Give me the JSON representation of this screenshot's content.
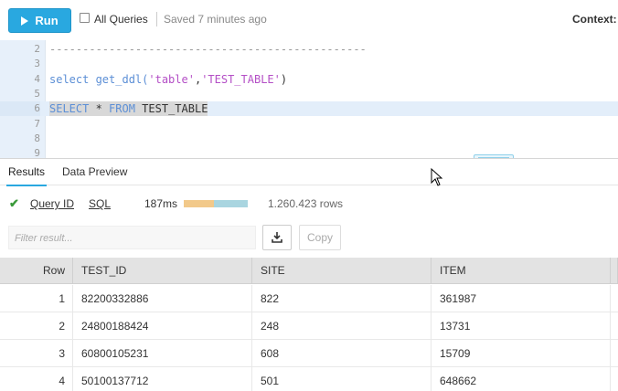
{
  "toolbar": {
    "run_label": "Run",
    "all_queries_label": "All Queries",
    "all_queries_checked": false,
    "saved_status": "Saved 7 minutes ago",
    "context_label": "Context:"
  },
  "editor": {
    "lines": [
      {
        "num": "2",
        "text": "------------------------------------------------"
      },
      {
        "num": "3",
        "text": ""
      },
      {
        "num": "4",
        "parts": [
          "select get_ddl(",
          "'table'",
          ",",
          "'TEST_TABLE'",
          ")"
        ]
      },
      {
        "num": "5",
        "text": ""
      },
      {
        "num": "6",
        "parts": [
          "SELECT",
          " * ",
          "FROM",
          " TEST_TABLE"
        ]
      },
      {
        "num": "7",
        "text": ""
      },
      {
        "num": "8",
        "text": ""
      },
      {
        "num": "9",
        "text": ""
      }
    ]
  },
  "results": {
    "tabs": [
      "Results",
      "Data Preview"
    ],
    "active_tab": "Results",
    "query_id_label": "Query ID",
    "sql_label": "SQL",
    "duration": "187ms",
    "duration_bar_fraction": 0.47,
    "row_count": "1.260.423 rows",
    "filter_placeholder": "Filter result...",
    "copy_label": "Copy",
    "columns": [
      "Row",
      "TEST_ID",
      "SITE",
      "ITEM"
    ],
    "rows": [
      [
        "1",
        "82200332886",
        "822",
        "361987"
      ],
      [
        "2",
        "24800188424",
        "248",
        "13731"
      ],
      [
        "3",
        "60800105231",
        "608",
        "15709"
      ],
      [
        "4",
        "50100137712",
        "501",
        "648662"
      ]
    ]
  },
  "colors": {
    "accent": "#29a8e0",
    "success": "#3a9a3a",
    "keyword": "#5c8fd6",
    "string": "#b44fc6"
  }
}
